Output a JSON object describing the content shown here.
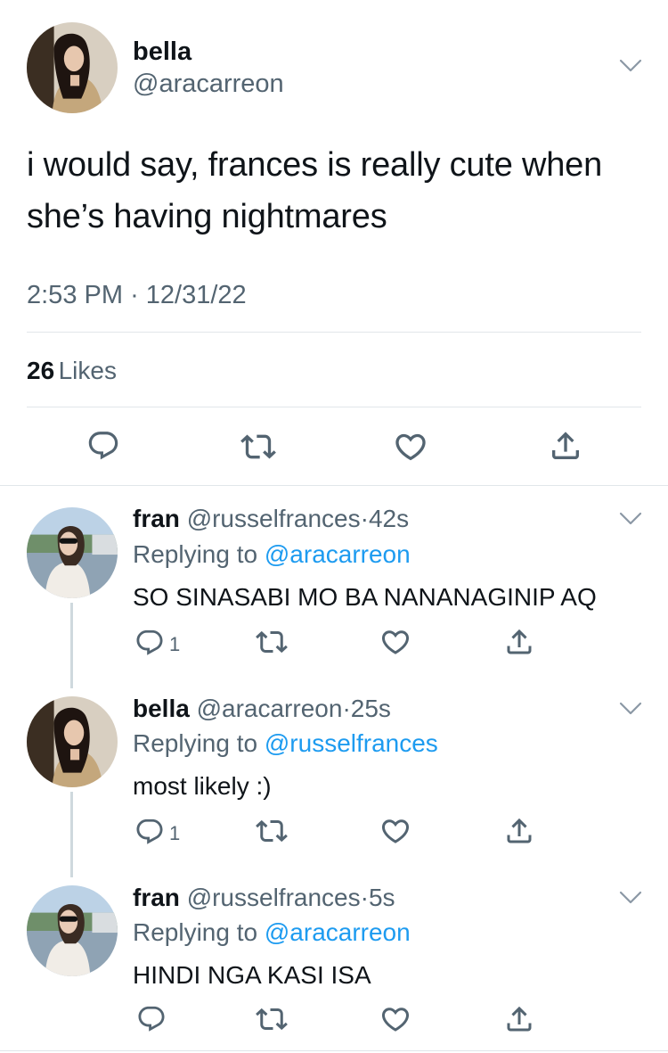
{
  "tweet": {
    "author_name": "bella",
    "author_handle": "@aracarreon",
    "text": "i would say, frances is really cute when she’s having nightmares",
    "time": "2:53 PM",
    "separator": "·",
    "date": "12/31/22",
    "likes_count": "26",
    "likes_label": "Likes"
  },
  "icons": {
    "reply": "reply-icon",
    "retweet": "retweet-icon",
    "like": "heart-icon",
    "share": "share-icon",
    "more": "chevron-down-icon"
  },
  "replies": [
    {
      "name": "fran",
      "handle": "@russelfrances",
      "dot": "·",
      "time": "42s",
      "replying_label": "Replying to",
      "replying_to": "@aracarreon",
      "text": "SO SINASABI MO BA NANANAGINIP AQ",
      "reply_count": "1"
    },
    {
      "name": "bella",
      "handle": "@aracarreon",
      "dot": "·",
      "time": "25s",
      "replying_label": "Replying to",
      "replying_to": "@russelfrances",
      "text": "most likely :)",
      "reply_count": "1"
    },
    {
      "name": "fran",
      "handle": "@russelfrances",
      "dot": "·",
      "time": "5s",
      "replying_label": "Replying to",
      "replying_to": "@aracarreon",
      "text": "HINDI NGA KASI ISA",
      "reply_count": ""
    }
  ],
  "colors": {
    "link": "#1d9bf0",
    "secondary": "#536471",
    "divider": "#e1e6ea"
  }
}
